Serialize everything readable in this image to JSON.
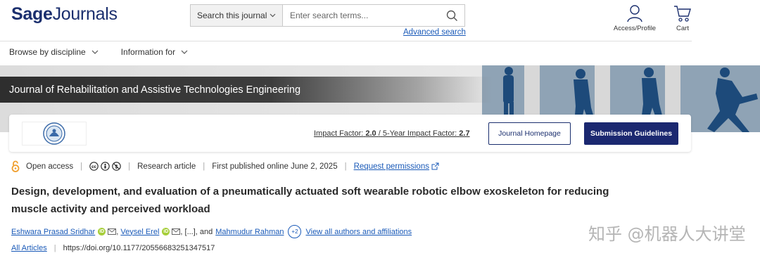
{
  "header": {
    "logo_bold": "Sage",
    "logo_rest": "Journals",
    "search": {
      "scope_label": "Search this journal",
      "placeholder": "Enter search terms...",
      "advanced_label": "Advanced search"
    },
    "access_label": "Access/Profile",
    "cart_label": "Cart"
  },
  "nav": {
    "items": [
      {
        "label": "Browse by discipline"
      },
      {
        "label": "Information for"
      }
    ]
  },
  "banner": {
    "journal_title": "Journal of Rehabilitation and Assistive Technologies Engineering"
  },
  "card": {
    "impact_label": "Impact Factor:",
    "impact_value": "2.0",
    "divider": "/",
    "five_year_label": "5-Year Impact Factor:",
    "five_year_value": "2.7",
    "homepage_button": "Journal Homepage",
    "submission_button": "Submission Guidelines"
  },
  "article": {
    "open_access": "Open access",
    "type": "Research article",
    "published": "First published online June 2, 2025",
    "request_permissions": "Request permissions",
    "title": "Design, development, and evaluation of a pneumatically actuated soft wearable robotic elbow exoskeleton for reducing muscle activity and perceived workload",
    "authors": [
      {
        "name": "Eshwara Prasad Sridhar"
      },
      {
        "name": "Veysel Erel"
      }
    ],
    "ellipsis": "[...], and",
    "last_author": "Mahmudur Rahman",
    "more_badge": "+2",
    "view_all": "View all authors and affiliations",
    "all_articles": "All Articles",
    "doi": "https://doi.org/10.1177/20556683251347517"
  },
  "watermark": "知乎 @机器人大讲堂",
  "colors": {
    "brand_navy": "#1b2f6e",
    "link_blue": "#1a5ab8",
    "orcid_green": "#a6ce39",
    "open_access_orange": "#f0a030"
  }
}
